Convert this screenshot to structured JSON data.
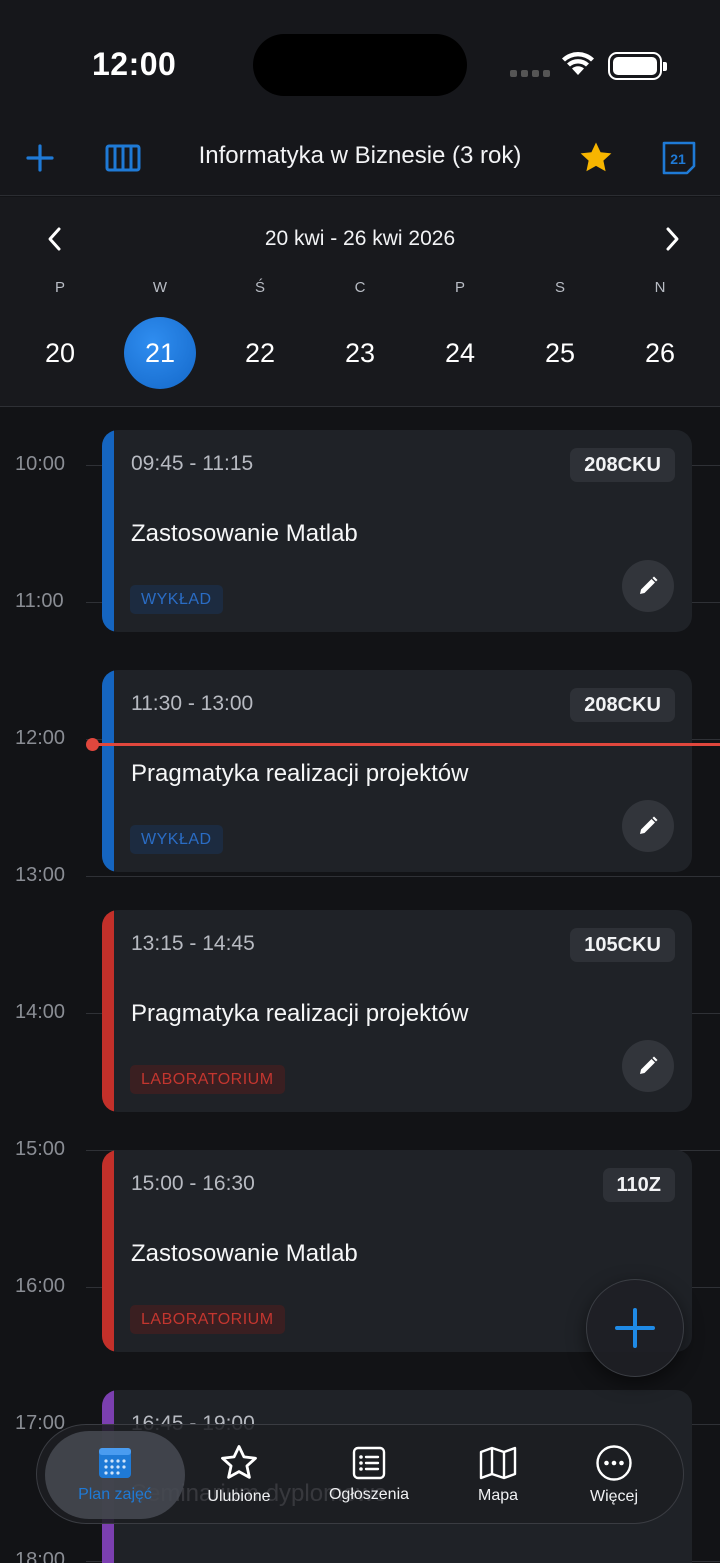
{
  "status_bar": {
    "time": "12:00"
  },
  "header": {
    "title": "Informatyka w Biznesie (3 rok)",
    "calendar_day": "21"
  },
  "week": {
    "range": "20 kwi - 26 kwi 2026",
    "days": [
      {
        "label": "P",
        "number": "20"
      },
      {
        "label": "W",
        "number": "21"
      },
      {
        "label": "Ś",
        "number": "22"
      },
      {
        "label": "C",
        "number": "23"
      },
      {
        "label": "P",
        "number": "24"
      },
      {
        "label": "S",
        "number": "25"
      },
      {
        "label": "N",
        "number": "26"
      }
    ],
    "selected_index": 1
  },
  "hours": [
    "10:00",
    "11:00",
    "12:00",
    "13:00",
    "14:00",
    "15:00",
    "16:00",
    "17:00",
    "18:00"
  ],
  "classes": [
    {
      "time": "09:45 - 11:15",
      "room": "208CKU",
      "title": "Zastosowanie Matlab",
      "type": "WYKŁAD",
      "color": "#1565c0"
    },
    {
      "time": "11:30 - 13:00",
      "room": "208CKU",
      "title": "Pragmatyka realizacji projektów",
      "type": "WYKŁAD",
      "color": "#1565c0"
    },
    {
      "time": "13:15 - 14:45",
      "room": "105CKU",
      "title": "Pragmatyka realizacji projektów",
      "type": "LABORATORIUM",
      "color": "#c3302a"
    },
    {
      "time": "15:00 - 16:30",
      "room": "110Z",
      "title": "Zastosowanie Matlab",
      "type": "LABORATORIUM",
      "color": "#c3302a"
    },
    {
      "time": "16:45 - 19:00",
      "room": "",
      "title": "Seminarium dyplomowe",
      "type": "",
      "color": "#7b3fb0"
    }
  ],
  "nav": [
    {
      "label": "Plan zajęć",
      "icon": "calendar-grid-icon"
    },
    {
      "label": "Ulubione",
      "icon": "star-outline-icon"
    },
    {
      "label": "Ogłoszenia",
      "icon": "list-icon"
    },
    {
      "label": "Mapa",
      "icon": "map-icon"
    },
    {
      "label": "Więcej",
      "icon": "more-dots-icon"
    }
  ]
}
